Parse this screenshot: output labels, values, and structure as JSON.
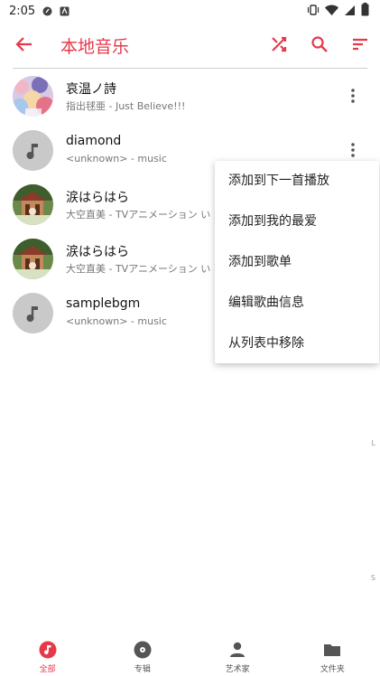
{
  "status_bar": {
    "time": "2:05"
  },
  "toolbar": {
    "title": "本地音乐",
    "back_icon": "arrow-left-icon",
    "shuffle_icon": "shuffle-icon",
    "search_icon": "search-icon",
    "sort_icon": "sort-icon"
  },
  "colors": {
    "accent": "#e5394a",
    "placeholder": "#c9c9c9"
  },
  "songs": [
    {
      "title": "哀温ノ詩",
      "subtitle": "指出毬亜 - Just Believe!!!",
      "cover": "album-art-anime"
    },
    {
      "title": "diamond",
      "subtitle": "<unknown> - music",
      "cover": "music-note-placeholder"
    },
    {
      "title": "涙はらはら",
      "subtitle": "大空直美 - TVアニメーション い",
      "cover": "album-art-forest"
    },
    {
      "title": "涙はらはら",
      "subtitle": "大空直美 - TVアニメーション い",
      "cover": "album-art-forest"
    },
    {
      "title": "samplebgm",
      "subtitle": "<unknown> - music",
      "cover": "music-note-placeholder"
    }
  ],
  "menu": {
    "items": [
      "添加到下一首播放",
      "添加到我的最爱",
      "添加到歌单",
      "编辑歌曲信息",
      "从列表中移除"
    ]
  },
  "index_letters": [
    "L",
    "S"
  ],
  "bottom_nav": [
    {
      "label": "全部",
      "icon": "music-note-icon",
      "active": true
    },
    {
      "label": "专辑",
      "icon": "album-icon",
      "active": false
    },
    {
      "label": "艺术家",
      "icon": "person-icon",
      "active": false
    },
    {
      "label": "文件夹",
      "icon": "folder-icon",
      "active": false
    }
  ]
}
